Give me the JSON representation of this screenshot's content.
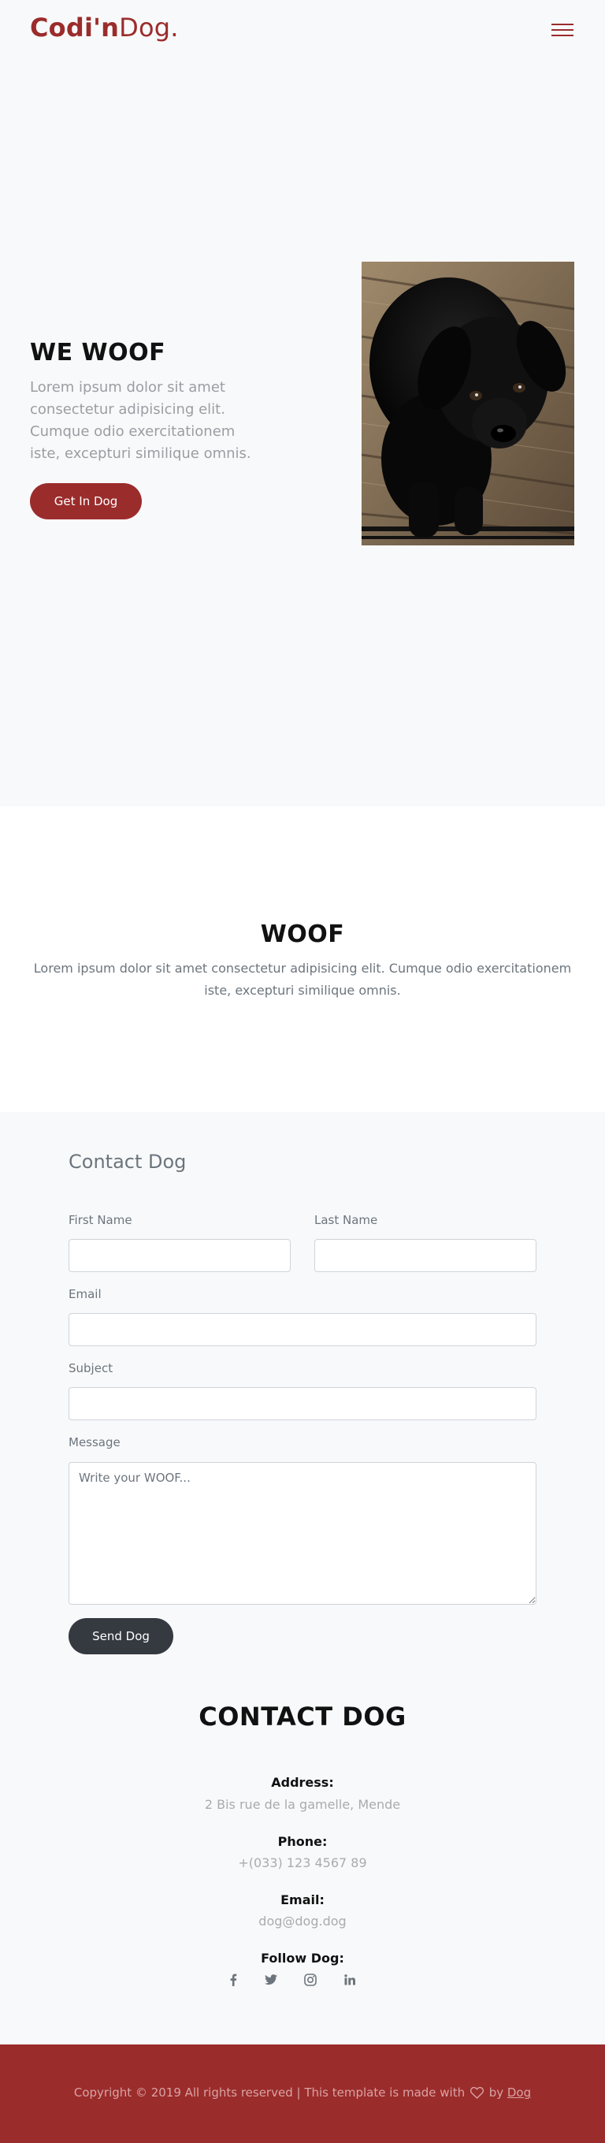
{
  "header": {
    "logo_bold": "Codi'n",
    "logo_light": "Dog."
  },
  "hero": {
    "title": "WE WOOF",
    "text": "Lorem ipsum dolor sit amet consectetur adipisicing elit. Cumque odio exercitationem iste, excepturi similique omnis.",
    "button": "Get In Dog"
  },
  "about": {
    "title": "WOOF",
    "text": "Lorem ipsum dolor sit amet consectetur adipisicing elit. Cumque odio exercitationem iste, excepturi similique omnis."
  },
  "contact_form": {
    "heading": "Contact Dog",
    "first_name_label": "First Name",
    "last_name_label": "Last Name",
    "email_label": "Email",
    "subject_label": "Subject",
    "message_label": "Message",
    "message_placeholder": "Write your WOOF...",
    "send_button": "Send Dog"
  },
  "contact_info": {
    "title": "CONTACT DOG",
    "address_label": "Address:",
    "address": "2 Bis rue de la gamelle, Mende",
    "phone_label": "Phone:",
    "phone": "+(033) 123 4567 89",
    "email_label": "Email:",
    "email": "dog@dog.dog",
    "follow_label": "Follow Dog:",
    "socials": [
      "facebook-icon",
      "twitter-icon",
      "instagram-icon",
      "linkedin-icon"
    ]
  },
  "footer": {
    "text": "Copyright © 2019 All rights reserved | This template is made with",
    "by": "by",
    "link": "Dog"
  },
  "colors": {
    "brand": "#9b2c2c",
    "dark_button": "#343a40",
    "page_bg": "#f8f9fa"
  }
}
